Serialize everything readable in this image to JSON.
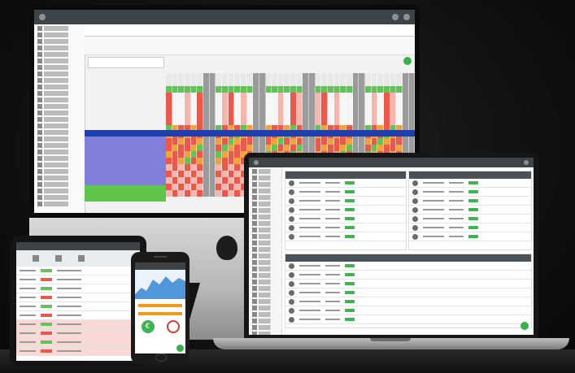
{
  "scene": {
    "description_tags": [
      "desktop-monitor",
      "laptop",
      "tablet",
      "smartphone"
    ],
    "colors": {
      "grid_red": "#e85b4c",
      "grid_green": "#66c15a",
      "grid_orange": "#f0a33b",
      "band_blue": "#1f3fae",
      "lavender": "#7f7fd9",
      "accent_green": "#36b24a",
      "topbar": "#3d4347"
    }
  },
  "devices": {
    "monitor": {
      "icon": "apple-logo-icon"
    },
    "laptop": {},
    "tablet": {},
    "phone": {}
  }
}
